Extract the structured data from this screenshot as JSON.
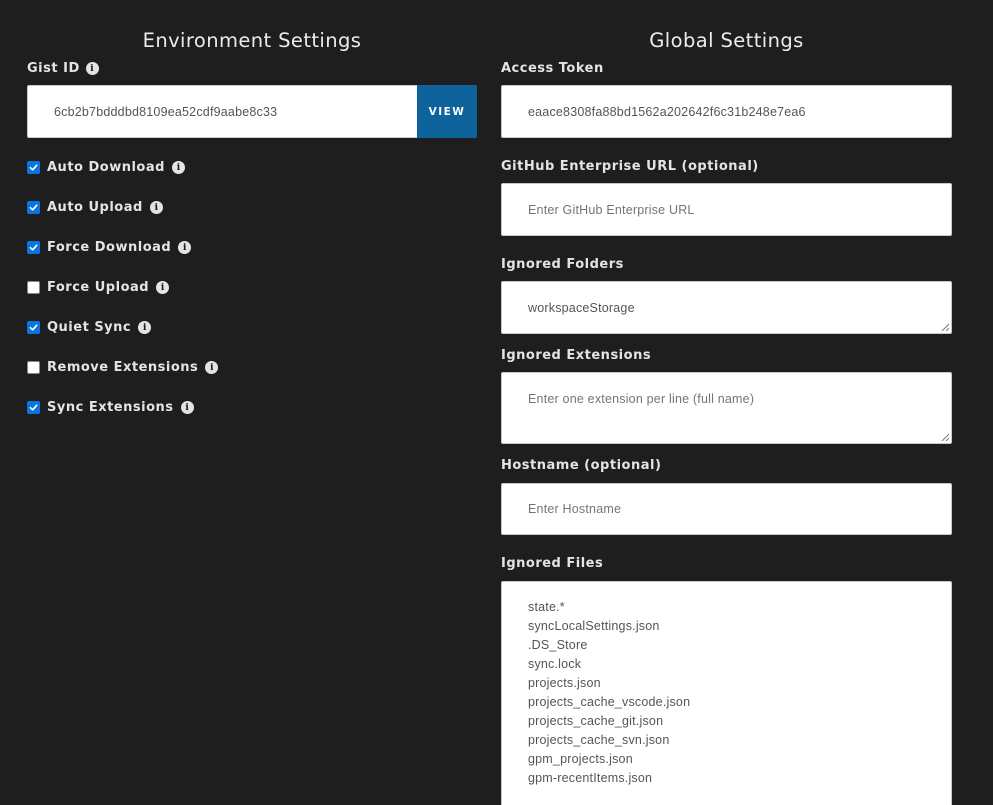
{
  "environment": {
    "title": "Environment Settings",
    "gist_label": "Gist ID",
    "gist_value": "6cb2b7bdddbd8109ea52cdf9aabe8c33",
    "view_button": "VIEW",
    "options": [
      {
        "label": "Auto Download",
        "checked": true
      },
      {
        "label": "Auto Upload",
        "checked": true
      },
      {
        "label": "Force Download",
        "checked": true
      },
      {
        "label": "Force Upload",
        "checked": false
      },
      {
        "label": "Quiet Sync",
        "checked": true
      },
      {
        "label": "Remove Extensions",
        "checked": false
      },
      {
        "label": "Sync Extensions",
        "checked": true
      }
    ]
  },
  "global": {
    "title": "Global Settings",
    "access_token_label": "Access Token",
    "access_token_value": "eaace8308fa88bd1562a202642f6c31b248e7ea6",
    "enterprise_url_label": "GitHub Enterprise URL (optional)",
    "enterprise_url_placeholder": "Enter GitHub Enterprise URL",
    "ignored_folders_label": "Ignored Folders",
    "ignored_folders_value": "workspaceStorage",
    "ignored_extensions_label": "Ignored Extensions",
    "ignored_extensions_placeholder": "Enter one extension per line (full name)",
    "hostname_label": "Hostname (optional)",
    "hostname_placeholder": "Enter Hostname",
    "ignored_files_label": "Ignored Files",
    "ignored_files": [
      "state.*",
      "syncLocalSettings.json",
      ".DS_Store",
      "sync.lock",
      "projects.json",
      "projects_cache_vscode.json",
      "projects_cache_git.json",
      "projects_cache_svn.json",
      "gpm_projects.json",
      "gpm-recentItems.json"
    ]
  },
  "icons": {
    "info": "info-icon",
    "check": "check-icon"
  },
  "colors": {
    "background": "#1e1e1e",
    "accent": "#0e639c",
    "checkbox": "#0b75e0"
  }
}
